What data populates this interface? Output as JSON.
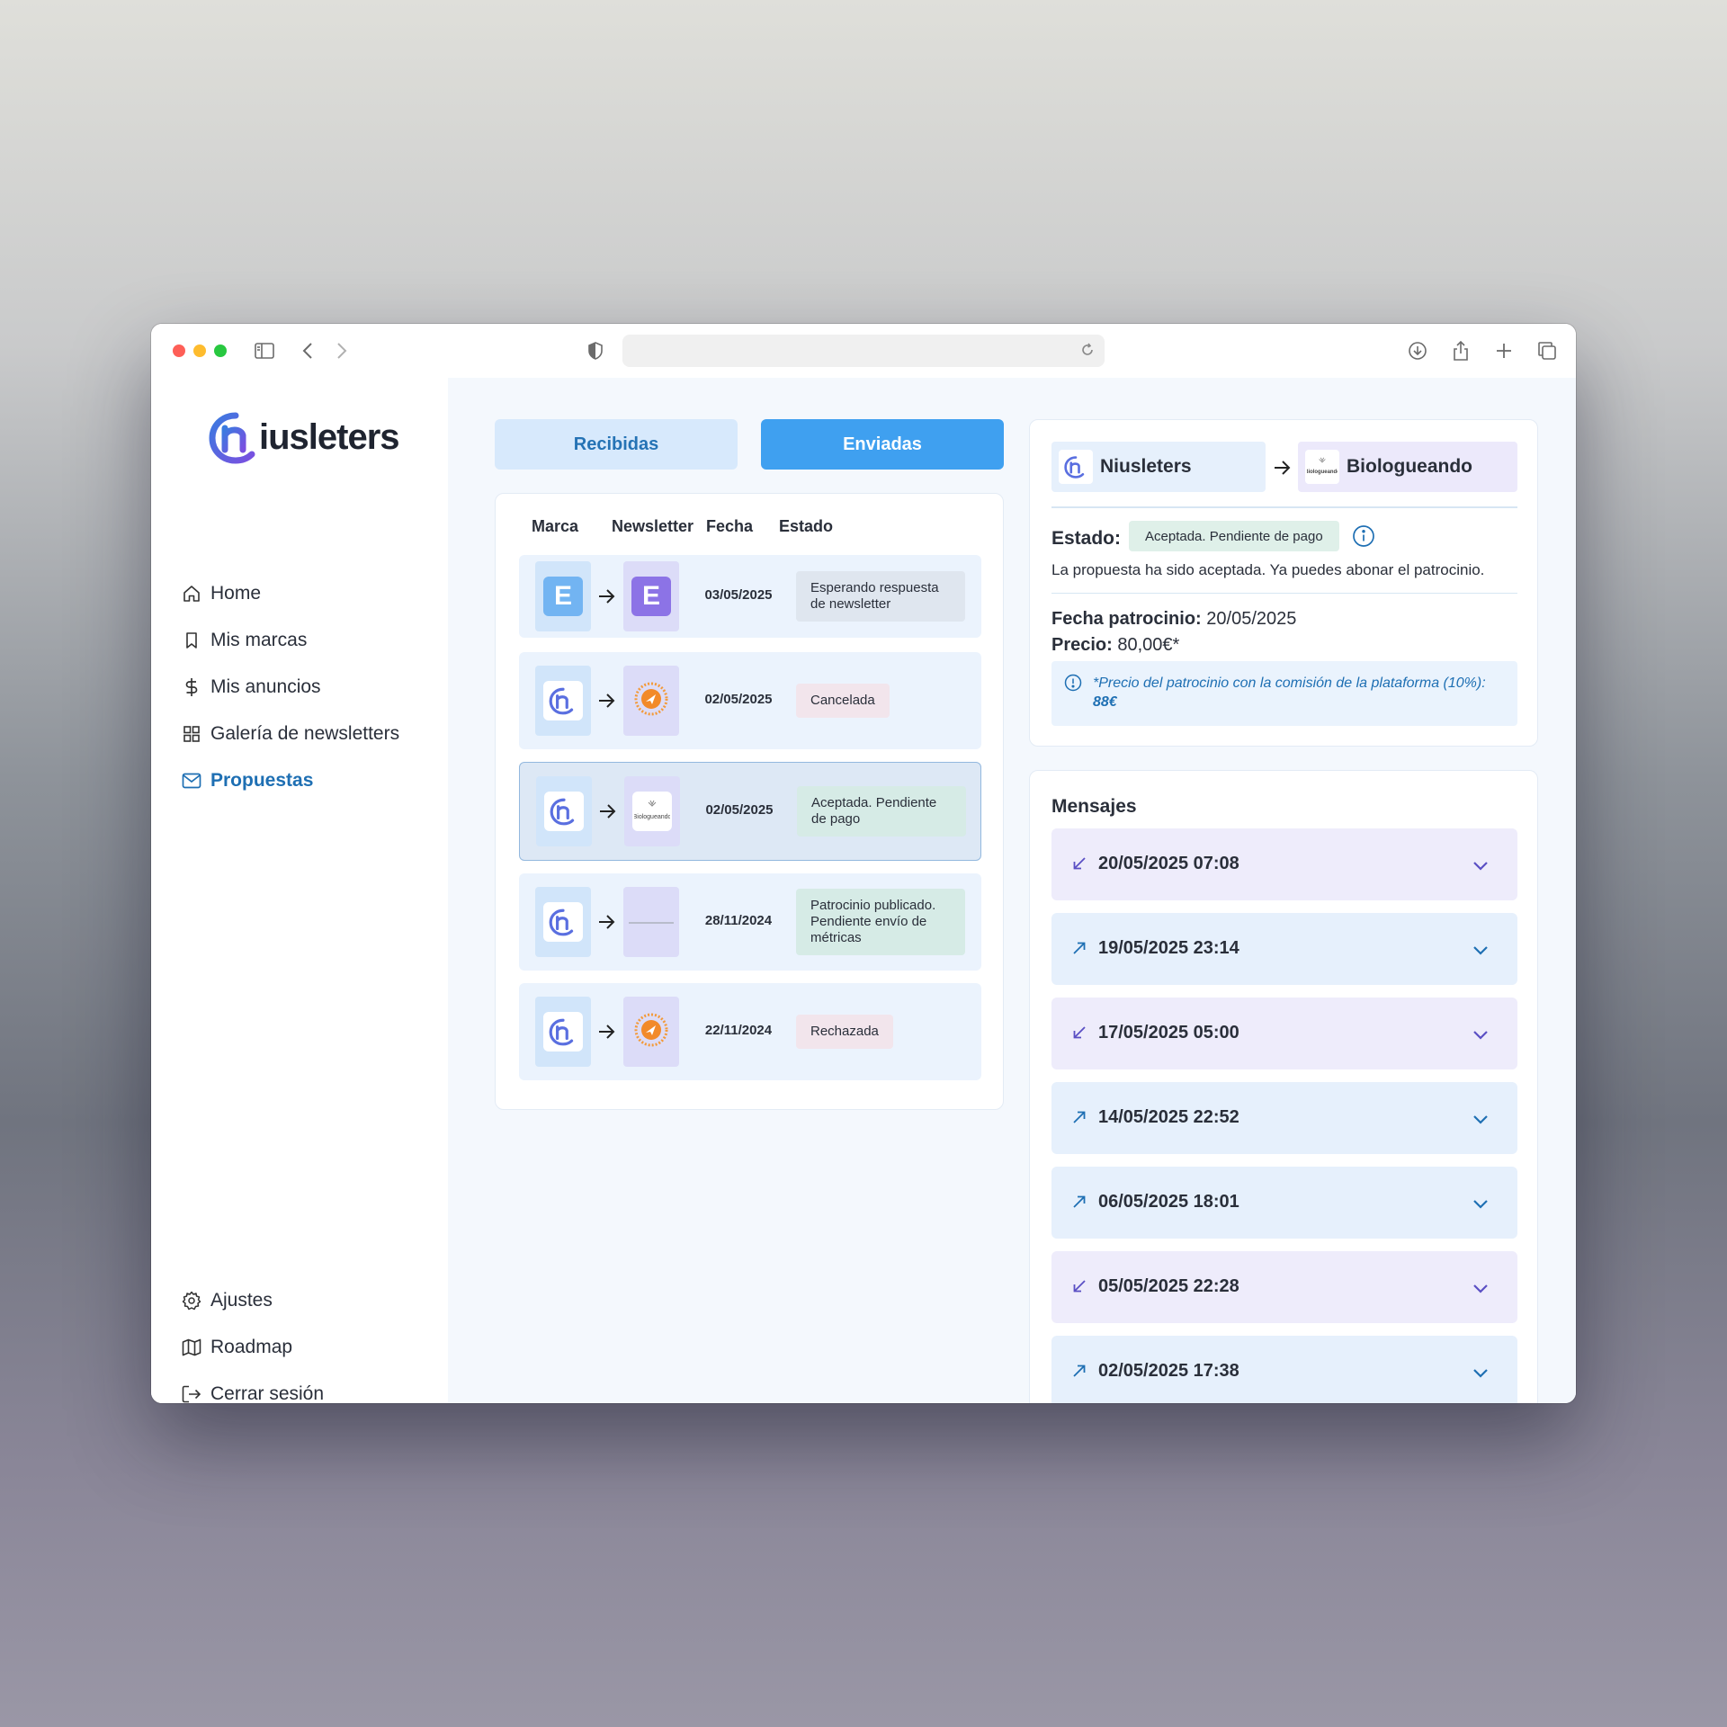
{
  "app": {
    "name": "Niusleters",
    "logo_text": "iusleters",
    "logo_mark": "n"
  },
  "nav": {
    "main": [
      {
        "label": "Home",
        "icon": "home-icon"
      },
      {
        "label": "Mis marcas",
        "icon": "bookmark-icon"
      },
      {
        "label": "Mis anuncios",
        "icon": "dollar-icon"
      },
      {
        "label": "Galería de newsletters",
        "icon": "grid-icon"
      },
      {
        "label": "Propuestas",
        "icon": "mail-icon",
        "active": true
      }
    ],
    "bottom": [
      {
        "label": "Ajustes",
        "icon": "gear-icon"
      },
      {
        "label": "Roadmap",
        "icon": "map-icon"
      },
      {
        "label": "Cerrar sesión",
        "icon": "logout-icon"
      }
    ]
  },
  "tabs": {
    "received": "Recibidas",
    "sent": "Enviadas",
    "active": "sent"
  },
  "list": {
    "headers": {
      "brand": "Marca",
      "newsletter": "Newsletter",
      "date": "Fecha",
      "status": "Estado"
    },
    "rows": [
      {
        "brand": "E",
        "newsletter": "E",
        "date": "03/05/2025",
        "status": "Esperando respuesta de newsletter",
        "status_color": "#dfe6ef"
      },
      {
        "brand": "niusleters-logo",
        "newsletter": "orange-seal-logo",
        "date": "02/05/2025",
        "status": "Cancelada",
        "status_color": "#f2e5ec"
      },
      {
        "brand": "niusleters-logo",
        "newsletter": "biologueando-logo",
        "date": "02/05/2025",
        "status": "Aceptada. Pendiente de pago",
        "status_color": "#d6ebe6",
        "selected": true
      },
      {
        "brand": "niusleters-logo",
        "newsletter": "faint-text-logo",
        "date": "28/11/2024",
        "status": "Patrocinio publicado. Pendiente envío de métricas",
        "status_color": "#d6ebe6"
      },
      {
        "brand": "niusleters-logo",
        "newsletter": "orange-seal-logo",
        "date": "22/11/2024",
        "status": "Rechazada",
        "status_color": "#f2e5ec"
      }
    ]
  },
  "detail": {
    "from": "Niusleters",
    "to": "Biologueando",
    "to_logo_text": "Biologueando",
    "estado_label": "Estado:",
    "estado_value": "Aceptada. Pendiente de pago",
    "description": "La propuesta ha sido aceptada. Ya puedes abonar el patrocinio.",
    "fecha_label": "Fecha patrocinio:",
    "fecha_value": "20/05/2025",
    "precio_label": "Precio:",
    "precio_value": "80,00€*",
    "note_text": "*Precio del patrocinio con la comisión de la plataforma (10%):",
    "note_amount": "88€"
  },
  "messages": {
    "title": "Mensajes",
    "items": [
      {
        "date": "20/05/2025 07:08",
        "direction": "in"
      },
      {
        "date": "19/05/2025 23:14",
        "direction": "out"
      },
      {
        "date": "17/05/2025 05:00",
        "direction": "in"
      },
      {
        "date": "14/05/2025 22:52",
        "direction": "out"
      },
      {
        "date": "06/05/2025 18:01",
        "direction": "out"
      },
      {
        "date": "05/05/2025 22:28",
        "direction": "in"
      },
      {
        "date": "02/05/2025 17:38",
        "direction": "out"
      }
    ]
  },
  "colors": {
    "accent": "#3fa0f0",
    "accent_dark": "#1e6fb3",
    "tab_inactive": "#d7e9fc",
    "main_bg": "#f4f8fd",
    "incoming": "#eeecfb",
    "outgoing": "#e6f0fc"
  }
}
